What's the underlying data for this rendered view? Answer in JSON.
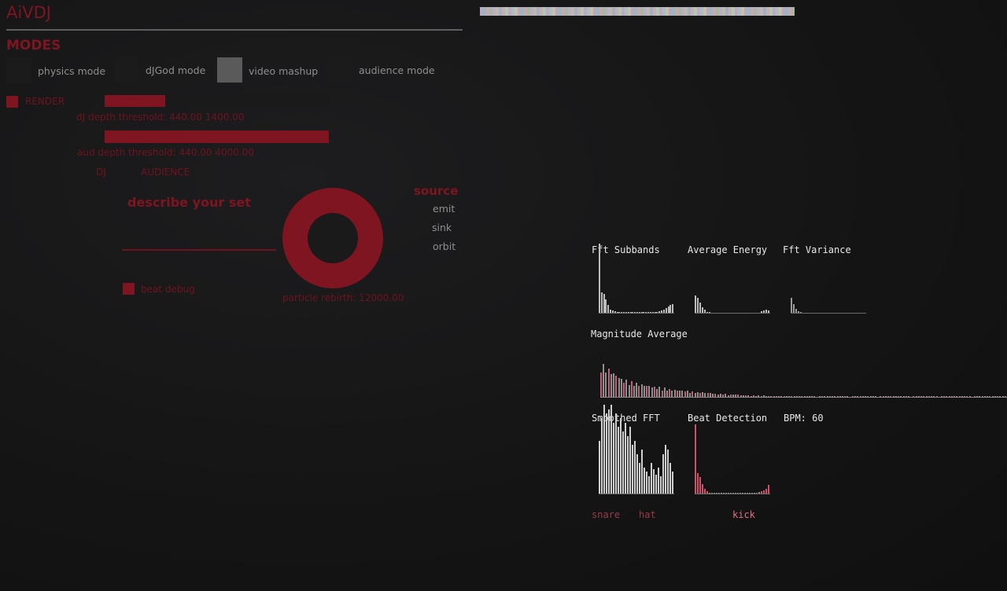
{
  "app": {
    "title": "AiVDJ"
  },
  "modes": {
    "heading": "MODES",
    "items": [
      {
        "label": "physics mode"
      },
      {
        "label": "dJGod mode"
      },
      {
        "label": "video mashup"
      },
      {
        "label": "audience mode"
      }
    ],
    "selected": "video mashup"
  },
  "render": {
    "label": "RENDER"
  },
  "dj_depth": {
    "label": "dJ depth threshold: 440.00 1400.00",
    "low": 440.0,
    "high": 1400.0
  },
  "aud_depth": {
    "label": "aud depth threshold: 440.00 4000.00",
    "low": 440.0,
    "high": 4000.0
  },
  "tabs": {
    "dj": "DJ",
    "audience": "AUDIENCE"
  },
  "describe": {
    "label": "describe your set",
    "value": ""
  },
  "beat_debug": {
    "label": "beat debug"
  },
  "particle": {
    "label": "particle rebirth: 12000.00",
    "value": 12000.0
  },
  "source": {
    "heading": "source",
    "items": [
      {
        "label": "emit"
      },
      {
        "label": "sink"
      },
      {
        "label": "orbit"
      }
    ]
  },
  "palette": [
    "#b8a8c8",
    "#9ab8b8",
    "#c8a8b8",
    "#a8b8a0",
    "#b8b0c8",
    "#c0b8a8",
    "#a0b0c8",
    "#c8b0b0",
    "#b0c8b8",
    "#c0a8c0",
    "#a8c0c0",
    "#c8c0a8"
  ],
  "analyzer": {
    "fft_subbands": "Fft Subbands",
    "average_energy": "Average Energy",
    "fft_variance": "Fft Variance",
    "magnitude_average": "Magnitude Average",
    "smoothed_fft": "Smoothed FFT",
    "beat_detection": "Beat Detection",
    "bpm": "BPM: 60",
    "snare": "snare",
    "hat": "hat",
    "kick": "kick"
  },
  "colors": {
    "accent": "#7e1521",
    "onset": "#d0506a"
  }
}
